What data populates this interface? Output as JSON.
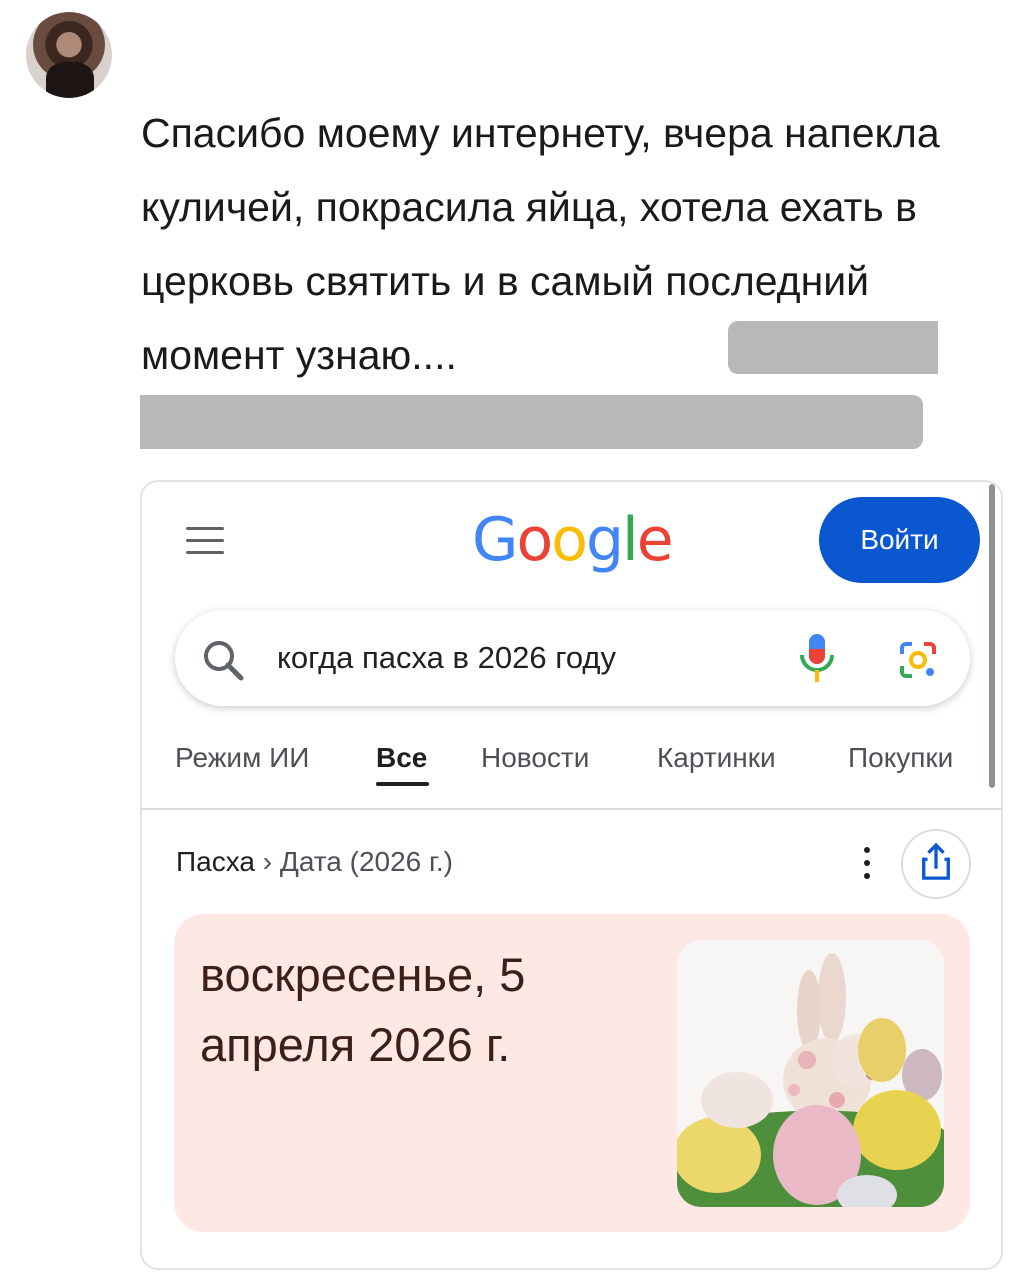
{
  "post": {
    "text": "Спасибо моему интернету, вчера напекла куличей, покрасила яйца, хотела ехать в церковь святить и в самый последний момент узнаю...."
  },
  "screenshot": {
    "logo": "Google",
    "signin_label": "Войти",
    "search_query": "когда пасха в 2026 году",
    "tabs": [
      "Режим ИИ",
      "Все",
      "Новости",
      "Картинки",
      "Покупки"
    ],
    "active_tab": "Все",
    "breadcrumb": {
      "topic": "Пасха",
      "separator": "›",
      "detail": "Дата (2026 г.)"
    },
    "answer": "воскресенье, 5 апреля 2026 г.",
    "icons": [
      "menu-icon",
      "search-icon",
      "mic-icon",
      "lens-icon",
      "more-vert-icon",
      "share-icon"
    ],
    "colors": {
      "signin": "#0b57d0",
      "answer_bg": "#fde8e3",
      "answer_text": "#3c1f17",
      "google_blue": "#4285f4",
      "google_red": "#ea4335",
      "google_yellow": "#fbbc05",
      "google_green": "#34a853"
    }
  }
}
